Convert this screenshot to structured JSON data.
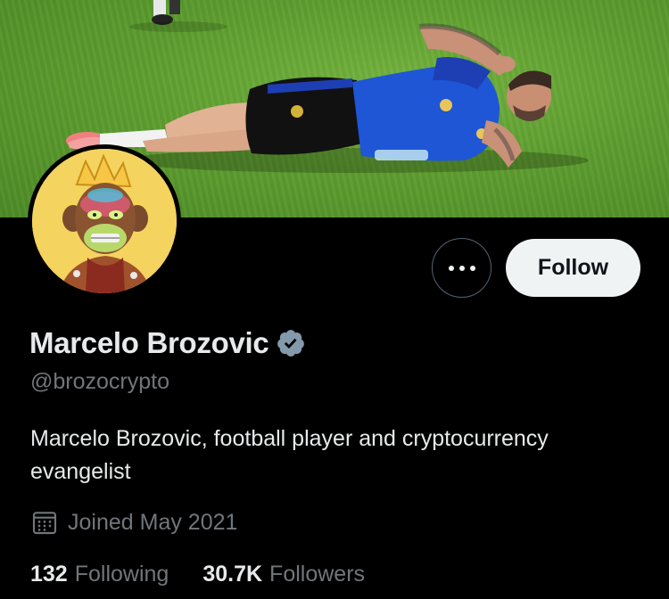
{
  "profile": {
    "display_name": "Marcelo Brozovic",
    "handle": "@brozocrypto",
    "bio": "Marcelo Brozovic, football player and cryptocurrency evangelist",
    "joined": "Joined May 2021",
    "verified": true
  },
  "actions": {
    "follow_label": "Follow",
    "more_icon": "more-horizontal-icon"
  },
  "stats": {
    "following_count": "132",
    "following_label": "Following",
    "followers_count": "30.7K",
    "followers_label": "Followers"
  },
  "icons": {
    "verified": "verified-badge-icon",
    "calendar": "calendar-icon"
  },
  "colors": {
    "background": "#000000",
    "primary_text": "#e7e9ea",
    "secondary_text": "#71767b",
    "button_bg": "#eff3f4",
    "button_text": "#0f1419",
    "outline": "#536471",
    "banner_grass": "#5e9e30",
    "avatar_bg": "#f4d35e"
  }
}
